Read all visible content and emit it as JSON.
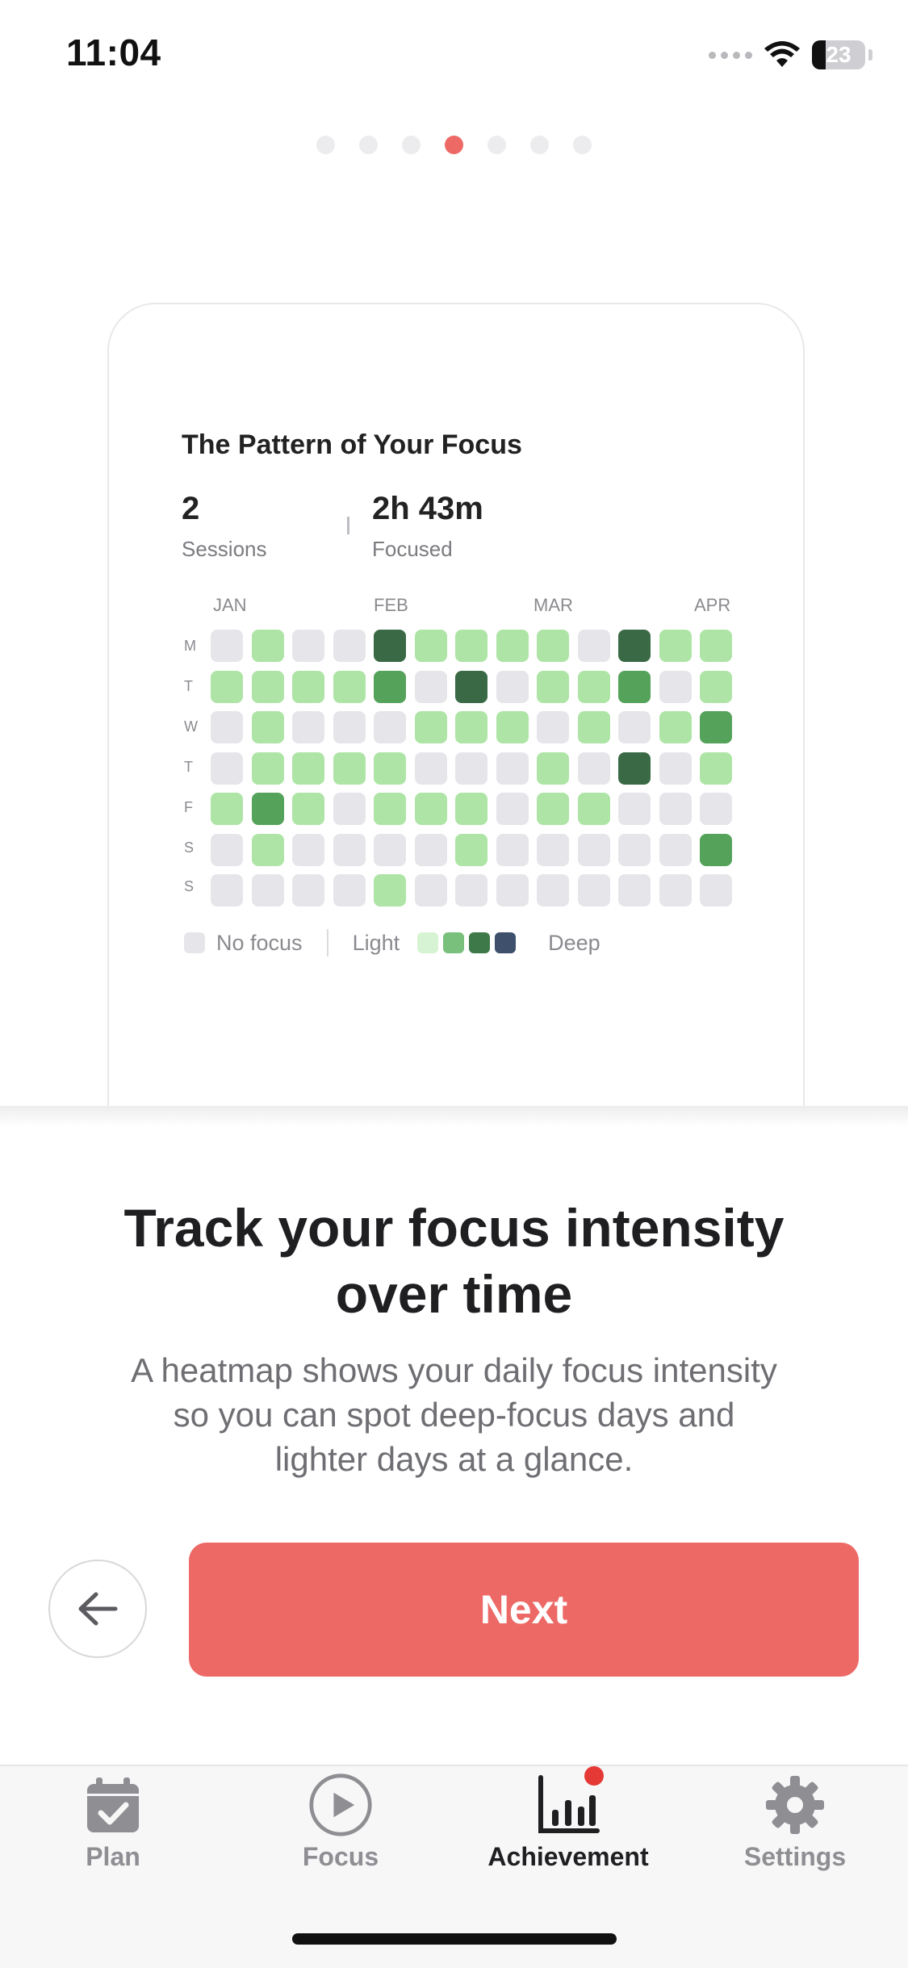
{
  "status": {
    "time": "11:04",
    "battery": "23"
  },
  "pagination": {
    "count": 7,
    "active_index": 3,
    "active_color": "#ec6966"
  },
  "card": {
    "title": "The Pattern of Your Focus",
    "stats": [
      {
        "value": "2",
        "label": "Sessions"
      },
      {
        "value": "2h 43m",
        "label": "Focused"
      }
    ],
    "heatmap": {
      "months": [
        "JAN",
        "FEB",
        "MAR",
        "APR"
      ],
      "days": [
        "M",
        "T",
        "W",
        "T",
        "F",
        "S",
        "S"
      ],
      "levels": [
        [
          0,
          1,
          0,
          0,
          3,
          1,
          1,
          1,
          1,
          0,
          3,
          1,
          1
        ],
        [
          1,
          1,
          1,
          1,
          2,
          0,
          3,
          0,
          1,
          1,
          2,
          0,
          1
        ],
        [
          0,
          1,
          0,
          0,
          0,
          1,
          1,
          1,
          0,
          1,
          0,
          1,
          2
        ],
        [
          0,
          1,
          1,
          1,
          1,
          0,
          0,
          0,
          1,
          0,
          3,
          0,
          1
        ],
        [
          1,
          2,
          1,
          0,
          1,
          1,
          1,
          0,
          1,
          1,
          0,
          0,
          0
        ],
        [
          0,
          1,
          0,
          0,
          0,
          0,
          1,
          0,
          0,
          0,
          0,
          0,
          2
        ],
        [
          0,
          0,
          0,
          0,
          1,
          0,
          0,
          0,
          0,
          0,
          0,
          0,
          0
        ]
      ],
      "level_colors": [
        "#e6e6ea",
        "#aee5a6",
        "#55a25b",
        "#3a6a45"
      ]
    },
    "legend": {
      "no_focus": "No focus",
      "light": "Light",
      "deep": "Deep",
      "scale_colors": [
        "#d6f3d3",
        "#79c07c",
        "#3e7a49",
        "#3e506c"
      ]
    }
  },
  "onboarding": {
    "headline_line1": "Track your focus intensity",
    "headline_line2": "over time",
    "description_line1": "A heatmap shows your daily focus intensity",
    "description_line2": "so you can spot deep-focus days and",
    "description_line3": "lighter days at a glance.",
    "next_label": "Next"
  },
  "tabs": [
    {
      "label": "Plan",
      "icon": "calendar-check-icon"
    },
    {
      "label": "Focus",
      "icon": "play-circle-icon"
    },
    {
      "label": "Achievement",
      "icon": "bar-chart-icon",
      "active": true,
      "badge_color": "#e53935"
    },
    {
      "label": "Settings",
      "icon": "gear-icon"
    }
  ]
}
